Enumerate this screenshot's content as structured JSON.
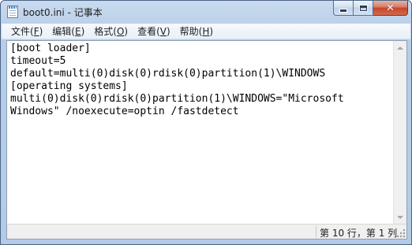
{
  "window": {
    "title": "boot0.ini - 记事本",
    "icon": "notepad-icon",
    "buttons": {
      "minimize": "minimize-icon",
      "maximize": "maximize-icon",
      "close": "close-icon"
    }
  },
  "menu": {
    "items": [
      {
        "label": "文件(",
        "accel": "F",
        "suffix": ")"
      },
      {
        "label": "编辑(",
        "accel": "E",
        "suffix": ")"
      },
      {
        "label": "格式(",
        "accel": "O",
        "suffix": ")"
      },
      {
        "label": "查看(",
        "accel": "V",
        "suffix": ")"
      },
      {
        "label": "帮助(",
        "accel": "H",
        "suffix": ")"
      }
    ]
  },
  "editor": {
    "content": "[boot loader]\ntimeout=5\ndefault=multi(0)disk(0)rdisk(0)partition(1)\\WINDOWS\n[operating systems]\nmulti(0)disk(0)rdisk(0)partition(1)\\WINDOWS=\"Microsoft\nWindows\" /noexecute=optin /fastdetect"
  },
  "status": {
    "position": "第 10 行，第 1 列"
  },
  "colors": {
    "frame": "#b9cfe9",
    "close_button": "#c4462a",
    "editor_bg": "#ffffff"
  }
}
